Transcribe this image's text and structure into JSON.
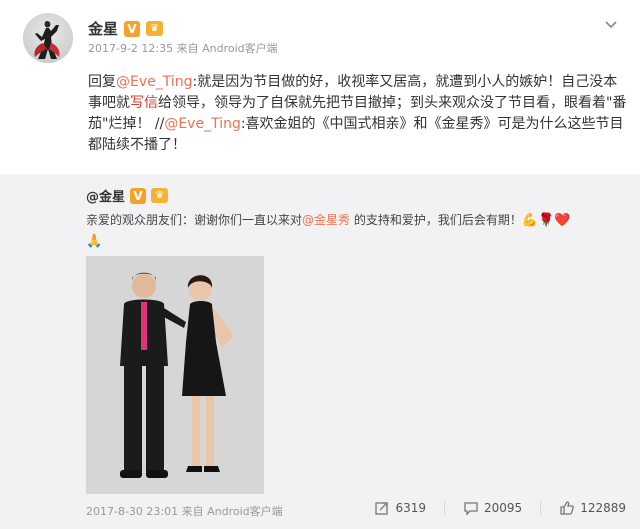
{
  "post": {
    "author": "金星",
    "verified_badge": "V",
    "meta": "2017-9-2 12:35 来自 Android客户端",
    "text_segments": [
      {
        "t": "回复",
        "k": "plain"
      },
      {
        "t": "@Eve_Ting",
        "k": "mention"
      },
      {
        "t": ":就是因为节目做的好，收视率又居高，就遭到小人的嫉妒！自己没本事吧就",
        "k": "plain"
      },
      {
        "t": "写信",
        "k": "red"
      },
      {
        "t": "给领导，领导为了自保就先把节目撤掉；到头来观众没了节目看，眼看着\"番茄\"烂掉！ //",
        "k": "plain"
      },
      {
        "t": "@Eve_Ting",
        "k": "mention"
      },
      {
        "t": ":喜欢金姐的《中国式相亲》和《金星秀》可是为什么这些节目都陆续不播了！",
        "k": "plain"
      }
    ]
  },
  "repost": {
    "author": "@金星",
    "verified_badge": "V",
    "text_segments": [
      {
        "t": "亲爱的观众朋友们：谢谢你们一直以来对",
        "k": "plain"
      },
      {
        "t": "@金星秀",
        "k": "mention"
      },
      {
        "t": " 的支持和爱护，我们后会有期！",
        "k": "plain"
      }
    ],
    "emojis": [
      "💪",
      "🌹",
      "❤️",
      "🙏"
    ],
    "meta": "2017-8-30 23:01 来自 Android客户端",
    "reposts": "6319",
    "comments": "20095",
    "likes": "122889"
  },
  "colors": {
    "mention": "#eb7350",
    "red_link": "#e0382a",
    "badge": "#f6a12c",
    "repost_bg": "#f2f2f5"
  }
}
